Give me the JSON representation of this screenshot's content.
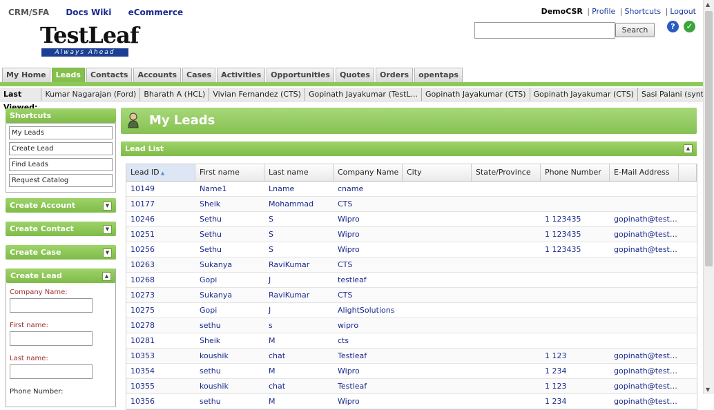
{
  "topnav": {
    "crm": "CRM/SFA",
    "docs": "Docs Wiki",
    "ecommerce": "eCommerce"
  },
  "userbar": {
    "user": "DemoCSR",
    "profile": "Profile",
    "shortcuts": "Shortcuts",
    "logout": "Logout"
  },
  "logo": {
    "word": "TestLeaf",
    "tagline": "Always Ahead"
  },
  "search": {
    "button": "Search",
    "value": ""
  },
  "tabs": [
    "My Home",
    "Leads",
    "Contacts",
    "Accounts",
    "Cases",
    "Activities",
    "Opportunities",
    "Quotes",
    "Orders",
    "opentaps"
  ],
  "active_tab": "Leads",
  "last_viewed": {
    "label": "Last Viewed:",
    "items": [
      "Kumar Nagarajan (Ford)",
      "Bharath A (HCL)",
      "Vivian Fernandez (CTS)",
      "Gopinath Jayakumar (TestL...",
      "Gopinath Jayakumar (CTS)",
      "Gopinath Jayakumar (CTS)",
      "Sasi Palani (syntel)"
    ]
  },
  "sidebar": {
    "shortcuts_title": "Shortcuts",
    "shortcuts": [
      "My Leads",
      "Create Lead",
      "Find Leads",
      "Request Catalog"
    ],
    "create_account": "Create Account",
    "create_contact": "Create Contact",
    "create_case": "Create Case",
    "create_lead": "Create Lead",
    "form": {
      "company": "Company Name:",
      "first": "First name:",
      "last": "Last name:",
      "phone": "Phone Number:"
    }
  },
  "page": {
    "title": "My Leads",
    "list_title": "Lead List"
  },
  "table": {
    "columns": [
      "Lead ID",
      "First name",
      "Last name",
      "Company Name",
      "City",
      "State/Province",
      "Phone Number",
      "E-Mail Address"
    ],
    "rows": [
      [
        "10149",
        "Name1",
        "Lname",
        "cname",
        "",
        "",
        "",
        ""
      ],
      [
        "10177",
        "Sheik",
        "Mohammad",
        "CTS",
        "",
        "",
        "",
        ""
      ],
      [
        "10246",
        "Sethu",
        "S",
        "Wipro",
        "",
        "",
        "1 123435",
        "gopinath@testl..."
      ],
      [
        "10251",
        "Sethu",
        "S",
        "Wipro",
        "",
        "",
        "1 123435",
        "gopinath@testl..."
      ],
      [
        "10256",
        "Sethu",
        "S",
        "Wipro",
        "",
        "",
        "1 123435",
        "gopinath@testl..."
      ],
      [
        "10263",
        "Sukanya",
        "RaviKumar",
        "CTS",
        "",
        "",
        "",
        ""
      ],
      [
        "10268",
        "Gopi",
        "J",
        "testleaf",
        "",
        "",
        "",
        ""
      ],
      [
        "10273",
        "Sukanya",
        "RaviKumar",
        "CTS",
        "",
        "",
        "",
        ""
      ],
      [
        "10275",
        "Gopi",
        "J",
        "AlightSolutions",
        "",
        "",
        "",
        ""
      ],
      [
        "10278",
        "sethu",
        "s",
        "wipro",
        "",
        "",
        "",
        ""
      ],
      [
        "10281",
        "Sheik",
        "M",
        "cts",
        "",
        "",
        "",
        ""
      ],
      [
        "10353",
        "koushik",
        "chat",
        "Testleaf",
        "",
        "",
        "1 123",
        "gopinath@testl..."
      ],
      [
        "10354",
        "sethu",
        "M",
        "Wipro",
        "",
        "",
        "1 234",
        "gopinath@testl..."
      ],
      [
        "10355",
        "koushik",
        "chat",
        "Testleaf",
        "",
        "",
        "1 123",
        "gopinath@testl..."
      ],
      [
        "10356",
        "sethu",
        "M",
        "Wipro",
        "",
        "",
        "1 234",
        "gopinath@testl..."
      ]
    ]
  },
  "colors": {
    "accent": "#85c04e",
    "link": "#1a2a8c",
    "required": "#a03030"
  }
}
